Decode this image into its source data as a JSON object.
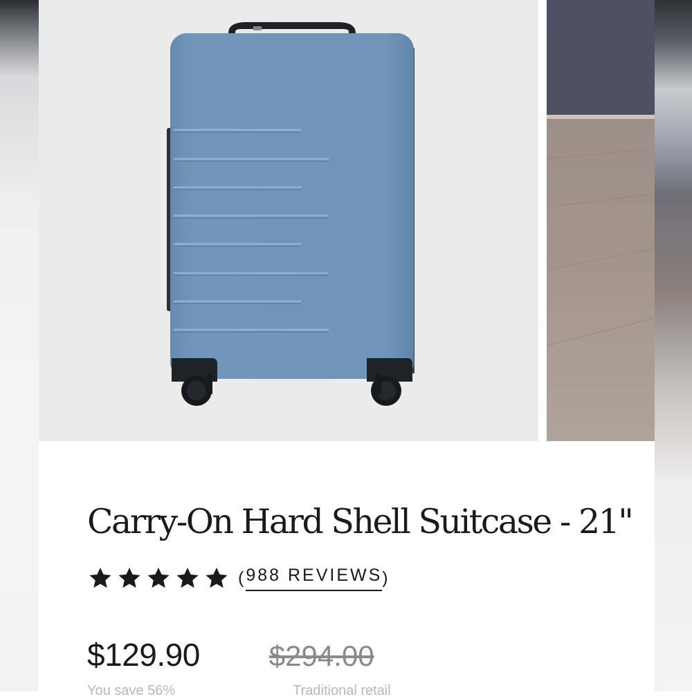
{
  "product": {
    "title": "Carry-On Hard Shell Suitcase - 21\"",
    "rating_stars": 5,
    "reviews_label": "988 REVIEWS",
    "reviews_open": "(",
    "reviews_close": ")",
    "current_price": "$129.90",
    "original_price": "$294.00",
    "savings_label": "You save 56%",
    "original_price_label": "Traditional retail"
  },
  "gallery": {
    "main_image_icon": "suitcase-image",
    "secondary_image_icon": "suitcase-lifestyle-image"
  },
  "colors": {
    "suitcase_body": "#6f93b8",
    "suitcase_shadow": "#5a7ea4",
    "background": "#ebebeb",
    "text": "#1a1a1a",
    "strike_price": "#8a8a8a"
  }
}
